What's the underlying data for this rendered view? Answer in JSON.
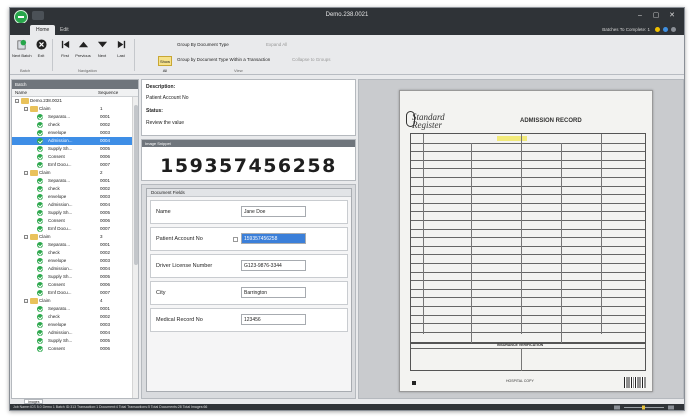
{
  "window": {
    "title": "Demo.238.0021",
    "tabs": [
      "Home",
      "Edit"
    ],
    "batches_label": "Batches To Complete: 1"
  },
  "ribbon": {
    "buttons": [
      {
        "label": "Next Batch",
        "icon": "next-batch-icon"
      },
      {
        "label": "Exit",
        "icon": "exit-icon"
      },
      {
        "label": "First",
        "icon": "first-icon"
      },
      {
        "label": "Previous",
        "icon": "previous-icon"
      },
      {
        "label": "Next",
        "icon": "next-icon"
      },
      {
        "label": "Last",
        "icon": "last-icon"
      }
    ],
    "group_labels": [
      "Batch",
      "Navigation",
      "View"
    ],
    "all_button": "Show All",
    "group_by_document_type": "Group By Document Type",
    "group_by_document_type_within": "Group by Document Type Within a Transaction",
    "expand_all": "Expand All",
    "collapse_to_groups": "Collapse to Groups"
  },
  "tree": {
    "panel_title": "Batch",
    "col_name": "Name",
    "col_sequence": "Sequence",
    "rows": [
      {
        "name": "Demo.238.0021",
        "seq": "",
        "level": 0,
        "kind": "root"
      },
      {
        "name": "Claim",
        "seq": "1",
        "level": 1,
        "kind": "folder"
      },
      {
        "name": "Separato...",
        "seq": "0001",
        "level": 2,
        "kind": "check"
      },
      {
        "name": "check",
        "seq": "0002",
        "level": 2,
        "kind": "check"
      },
      {
        "name": "envelope",
        "seq": "0003",
        "level": 2,
        "kind": "check"
      },
      {
        "name": "Admission...",
        "seq": "0004",
        "level": 2,
        "kind": "check",
        "selected": true
      },
      {
        "name": "Supply Sh...",
        "seq": "0005",
        "level": 2,
        "kind": "check"
      },
      {
        "name": "Consent",
        "seq": "0006",
        "level": 2,
        "kind": "check"
      },
      {
        "name": "Emf Docu...",
        "seq": "0007",
        "level": 2,
        "kind": "check"
      },
      {
        "name": "Claim",
        "seq": "2",
        "level": 1,
        "kind": "folder"
      },
      {
        "name": "Separato...",
        "seq": "0001",
        "level": 2,
        "kind": "check"
      },
      {
        "name": "check",
        "seq": "0002",
        "level": 2,
        "kind": "check"
      },
      {
        "name": "envelope",
        "seq": "0003",
        "level": 2,
        "kind": "check"
      },
      {
        "name": "Admission...",
        "seq": "0004",
        "level": 2,
        "kind": "check"
      },
      {
        "name": "Supply Sh...",
        "seq": "0005",
        "level": 2,
        "kind": "check"
      },
      {
        "name": "Consent",
        "seq": "0006",
        "level": 2,
        "kind": "check"
      },
      {
        "name": "Emf Docu...",
        "seq": "0007",
        "level": 2,
        "kind": "check"
      },
      {
        "name": "Claim",
        "seq": "3",
        "level": 1,
        "kind": "folder"
      },
      {
        "name": "Separato...",
        "seq": "0001",
        "level": 2,
        "kind": "check"
      },
      {
        "name": "check",
        "seq": "0002",
        "level": 2,
        "kind": "check"
      },
      {
        "name": "envelope",
        "seq": "0003",
        "level": 2,
        "kind": "check"
      },
      {
        "name": "Admission...",
        "seq": "0004",
        "level": 2,
        "kind": "check"
      },
      {
        "name": "Supply Sh...",
        "seq": "0005",
        "level": 2,
        "kind": "check"
      },
      {
        "name": "Consent",
        "seq": "0006",
        "level": 2,
        "kind": "check"
      },
      {
        "name": "Emf Docu...",
        "seq": "0007",
        "level": 2,
        "kind": "check"
      },
      {
        "name": "Claim",
        "seq": "4",
        "level": 1,
        "kind": "folder"
      },
      {
        "name": "Separato...",
        "seq": "0001",
        "level": 2,
        "kind": "check"
      },
      {
        "name": "check",
        "seq": "0002",
        "level": 2,
        "kind": "check"
      },
      {
        "name": "envelope",
        "seq": "0003",
        "level": 2,
        "kind": "check"
      },
      {
        "name": "Admission...",
        "seq": "0004",
        "level": 2,
        "kind": "check"
      },
      {
        "name": "Supply Sh...",
        "seq": "0005",
        "level": 2,
        "kind": "check"
      },
      {
        "name": "Consent",
        "seq": "0006",
        "level": 2,
        "kind": "check"
      }
    ]
  },
  "description": {
    "description_label": "Description:",
    "description_value": "Patient Account No",
    "status_label": "Status:",
    "status_value": "Review the value"
  },
  "snippet": {
    "title": "Image Snippet",
    "value": "159357456258"
  },
  "fields": {
    "title": "Document Fields",
    "items": [
      {
        "label": "Name",
        "value": "Jane Doe",
        "highlight": false
      },
      {
        "label": "Patient Account No",
        "value": "159357456258",
        "highlight": true
      },
      {
        "label": "Driver License Number",
        "value": "G123-9876-3344",
        "highlight": false
      },
      {
        "label": "City",
        "value": "Barrington",
        "highlight": false
      },
      {
        "label": "Medical Record No",
        "value": "123456",
        "highlight": false
      }
    ]
  },
  "document": {
    "logo_line1": "Standard",
    "logo_line2": "Register",
    "title": "ADMISSION RECORD",
    "verification": "INSURANCE VERIFICATION",
    "footer": "HOSPITAL COPY"
  },
  "bottom": {
    "images_tab": "Images",
    "status": "Job Name:ICS 5.0 Demo 1   Batch ID:313   Transaction:1   Document:4   Total Transactions:5   Total Documents:28   Total Images:66"
  },
  "colors": {
    "accent": "#27a64a",
    "selection": "#3e8ee6",
    "titlebar": "#2f3337"
  }
}
